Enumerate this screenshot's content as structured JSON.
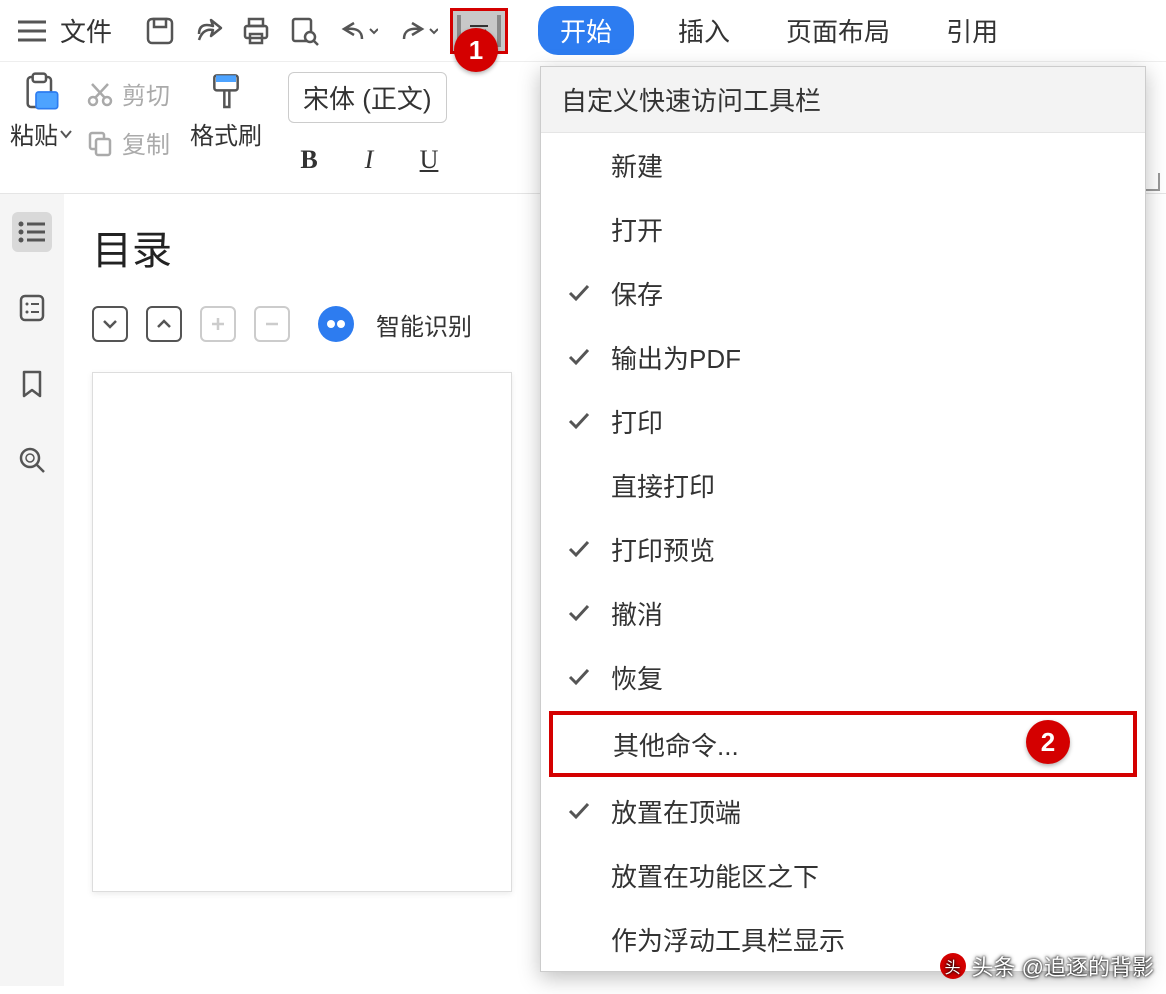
{
  "menubar": {
    "file_label": "文件"
  },
  "tabs": {
    "start": "开始",
    "insert": "插入",
    "layout": "页面布局",
    "reference": "引用"
  },
  "ribbon": {
    "paste_label": "粘贴",
    "cut_label": "剪切",
    "copy_label": "复制",
    "format_painter_label": "格式刷",
    "font_name": "宋体 (正文)",
    "bold": "B",
    "italic": "I",
    "underline": "U"
  },
  "nav": {
    "title": "目录",
    "smart_label": "智能识别"
  },
  "dropdown": {
    "header": "自定义快速访问工具栏",
    "items": [
      {
        "label": "新建",
        "checked": false
      },
      {
        "label": "打开",
        "checked": false
      },
      {
        "label": "保存",
        "checked": true
      },
      {
        "label": "输出为PDF",
        "checked": true
      },
      {
        "label": "打印",
        "checked": true
      },
      {
        "label": "直接打印",
        "checked": false
      },
      {
        "label": "打印预览",
        "checked": true
      },
      {
        "label": "撤消",
        "checked": true
      },
      {
        "label": "恢复",
        "checked": true
      },
      {
        "label": "其他命令...",
        "checked": false,
        "highlight": true
      },
      {
        "label": "放置在顶端",
        "checked": true
      },
      {
        "label": "放置在功能区之下",
        "checked": false
      },
      {
        "label": "作为浮动工具栏显示",
        "checked": false
      }
    ]
  },
  "callouts": {
    "one": "1",
    "two": "2"
  },
  "watermark": {
    "text": "头条 @追逐的背影"
  }
}
